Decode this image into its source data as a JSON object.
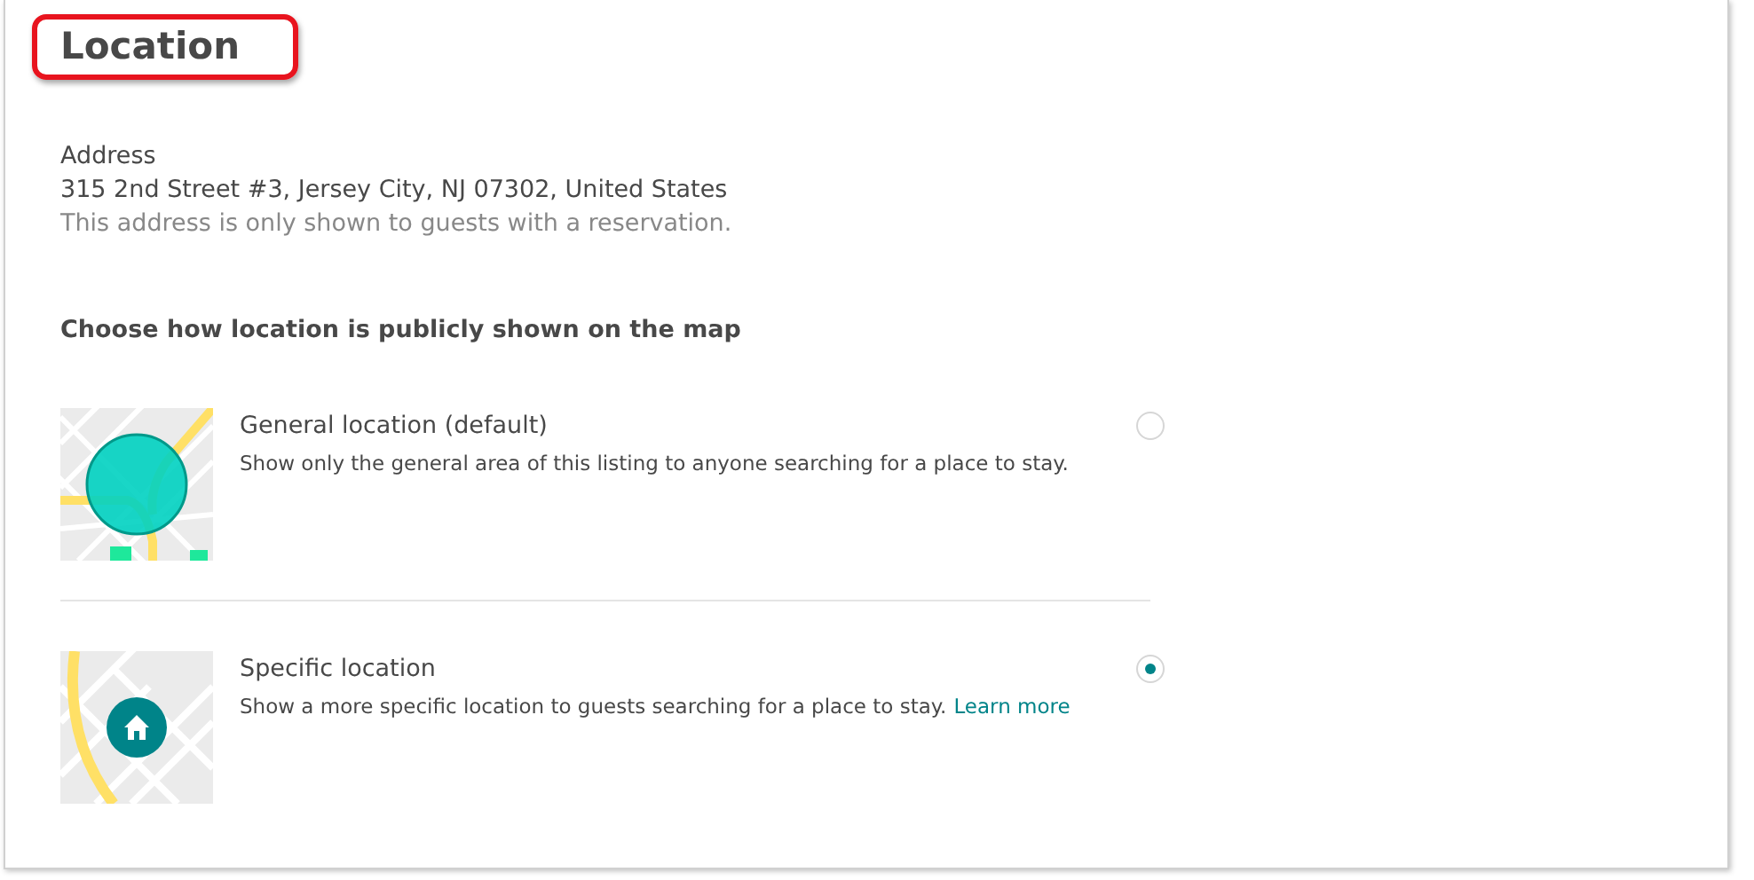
{
  "title": "Location",
  "address": {
    "label": "Address",
    "value": "315 2nd Street #3, Jersey City, NJ 07302, United States",
    "note": "This address is only shown to guests with a reservation."
  },
  "map_section": {
    "heading": "Choose how location is publicly shown on the map",
    "options": [
      {
        "kind": "area",
        "title": "General location (default)",
        "description": "Show only the general area of this listing to anyone searching for a place to stay.",
        "selected": false
      },
      {
        "kind": "pin",
        "title": "Specific location",
        "description": "Show a more specific location to guests searching for a place to stay.",
        "link": "Learn more",
        "selected": true
      }
    ]
  }
}
